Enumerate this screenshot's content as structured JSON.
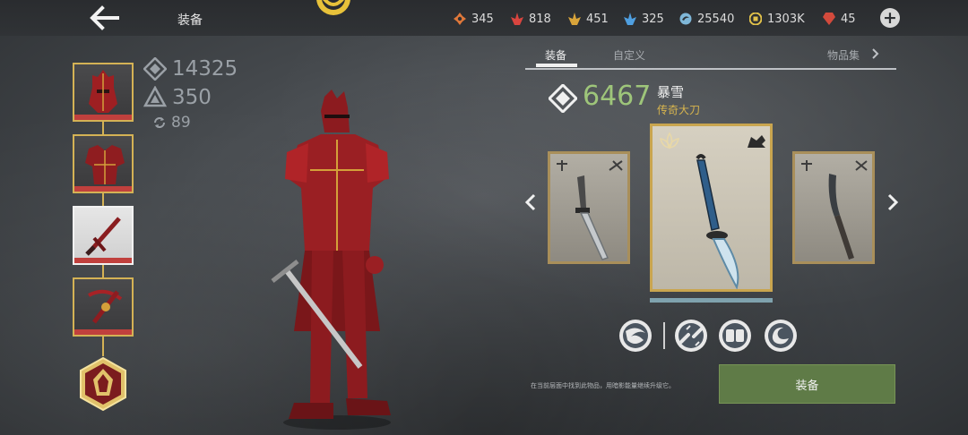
{
  "header": {
    "title": "装备",
    "back_icon": "arrow-left-icon",
    "emblem_icon": "clan-emblem-icon"
  },
  "resources": [
    {
      "name": "orange-gem",
      "value": "345",
      "color": "#e0783a"
    },
    {
      "name": "red-crystal",
      "value": "818",
      "color": "#d9453f"
    },
    {
      "name": "gold-crystal",
      "value": "451",
      "color": "#d9a43a"
    },
    {
      "name": "blue-crystal",
      "value": "325",
      "color": "#4f9fe0"
    },
    {
      "name": "energy-orb",
      "value": "25540",
      "color": "#7fb7d8"
    },
    {
      "name": "gold-coin",
      "value": "1303K",
      "color": "#e2c24a"
    },
    {
      "name": "ruby",
      "value": "45",
      "color": "#d24a3c"
    }
  ],
  "add_button": "+",
  "stats": {
    "power": "14325",
    "level": "350",
    "enhance": "89"
  },
  "slots": [
    {
      "name": "helmet",
      "selected": false
    },
    {
      "name": "armor",
      "selected": false
    },
    {
      "name": "weapon",
      "selected": true
    },
    {
      "name": "ranged",
      "selected": false
    }
  ],
  "tabs": {
    "equipment": "装备",
    "custom": "自定义",
    "collection": "物品集"
  },
  "weapon": {
    "power": "6467",
    "name": "暴雪",
    "rarity": "传奇大刀"
  },
  "hint": "在当前层面中找到此物品，用暗影能量继续升级它。",
  "equip_button": "装备",
  "colors": {
    "accent_green": "#9ec57a",
    "gold": "#d8b54e",
    "button_green": "#5f7b47"
  }
}
